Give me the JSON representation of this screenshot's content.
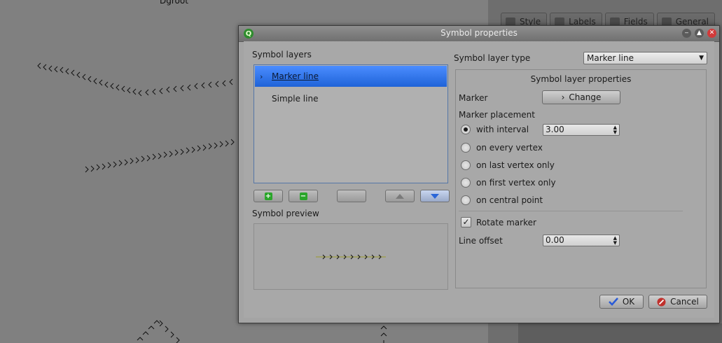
{
  "background": {
    "top_label": "Dgroot",
    "tabs": [
      {
        "label": "Style",
        "icon": "paintbrush-icon"
      },
      {
        "label": "Labels",
        "icon": "labels-icon"
      },
      {
        "label": "Fields",
        "icon": "table-icon"
      },
      {
        "label": "General",
        "icon": "wrench-icon"
      }
    ]
  },
  "dialog": {
    "title": "Symbol properties",
    "app_icon_letter": "Q",
    "symbol_layers_label": "Symbol layers",
    "layers": [
      {
        "label": "Marker line",
        "selected": true
      },
      {
        "label": "Simple line",
        "selected": false
      }
    ],
    "symbol_preview_label": "Symbol preview",
    "layer_type_label": "Symbol layer type",
    "layer_type_value": "Marker line",
    "props_title": "Symbol layer properties",
    "marker_label": "Marker",
    "change_button": "Change",
    "placement_label": "Marker placement",
    "placements": [
      {
        "label": "with interval",
        "checked": true
      },
      {
        "label": "on every vertex",
        "checked": false
      },
      {
        "label": "on last vertex only",
        "checked": false
      },
      {
        "label": "on first vertex only",
        "checked": false
      },
      {
        "label": "on central point",
        "checked": false
      }
    ],
    "interval_value": "3.00",
    "rotate_marker_label": "Rotate marker",
    "rotate_marker_checked": true,
    "line_offset_label": "Line offset",
    "line_offset_value": "0.00",
    "ok_button": "OK",
    "cancel_button": "Cancel"
  },
  "colors": {
    "selection_blue": "#2f74ee",
    "ok_check": "#2a5bd7",
    "cancel_red": "#c0312d"
  }
}
